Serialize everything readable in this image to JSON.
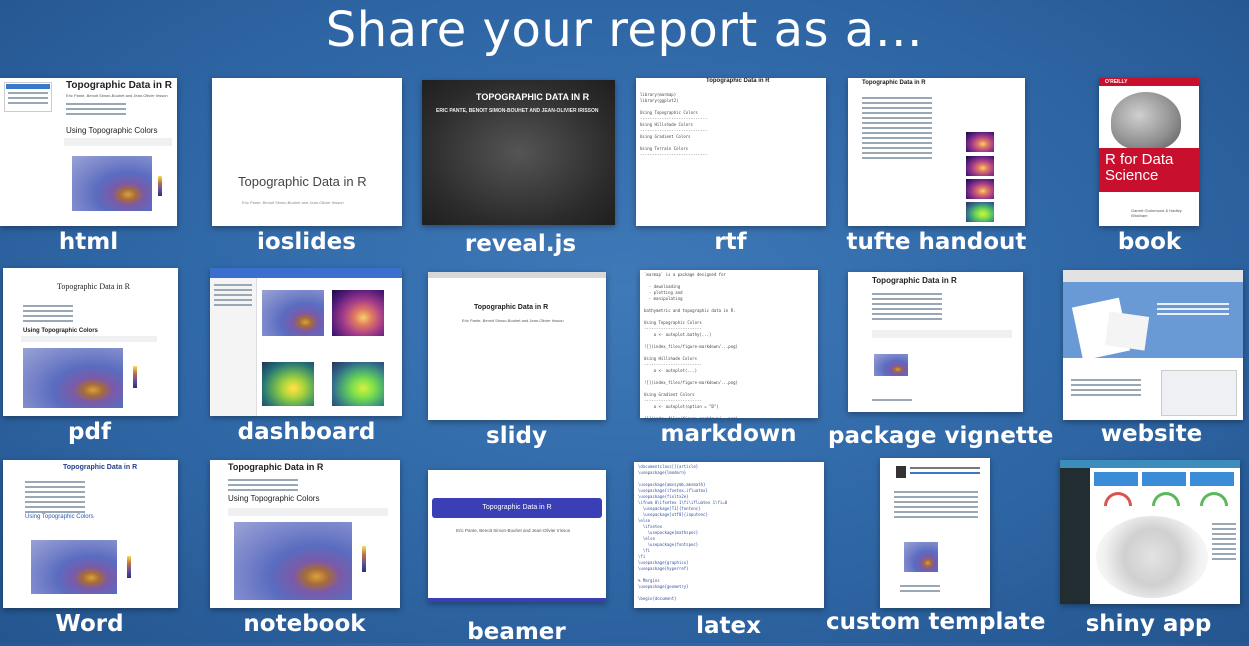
{
  "heading": "Share your report as a…",
  "tiles": [
    {
      "label": "html"
    },
    {
      "label": "ioslides"
    },
    {
      "label": "reveal.js"
    },
    {
      "label": "rtf"
    },
    {
      "label": "tufte handout"
    },
    {
      "label": "book"
    },
    {
      "label": "pdf"
    },
    {
      "label": "dashboard"
    },
    {
      "label": "slidy"
    },
    {
      "label": "markdown"
    },
    {
      "label": "package vignette"
    },
    {
      "label": "website"
    },
    {
      "label": "Word"
    },
    {
      "label": "notebook"
    },
    {
      "label": "beamer"
    },
    {
      "label": "latex"
    },
    {
      "label": "custom template"
    },
    {
      "label": "shiny app"
    }
  ],
  "thumbs": {
    "doc_title": "Topographic Data in R",
    "doc_authors": "Eric Pante, Benoit Simon-Bouhet and Jean-Olivier Irisson",
    "section": "Using Topographic Colors",
    "reveal_title": "TOPOGRAPHIC DATA IN R",
    "reveal_authors": "ERIC PANTE, BENOIT SIMON-BOUHET AND JEAN-OLIVIER IRISSON",
    "book_publisher": "O'REILLY",
    "book_title": "R for Data Science",
    "book_authors": "Garrett Grolemund & Hadley Wickham"
  },
  "colors": {
    "background": "#2f67a6",
    "label_text": "#ffffff",
    "book_red": "#c8102e",
    "beamer_blue": "#3b3fb6"
  }
}
